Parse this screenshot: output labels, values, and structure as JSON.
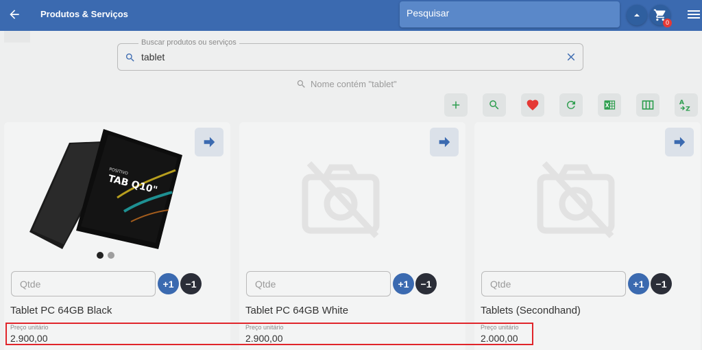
{
  "header": {
    "title": "Produtos & Serviços",
    "search_label": "Pesquisar",
    "cart_count": "0"
  },
  "search": {
    "label": "Buscar produtos ou serviços",
    "value": "tablet"
  },
  "filter": {
    "text": "Nome contém \"tablet\""
  },
  "toolbar": {
    "icons": [
      "add-icon",
      "search-icon",
      "heart-icon",
      "refresh-icon",
      "excel-icon",
      "columns-icon",
      "sort-az-icon"
    ]
  },
  "products": [
    {
      "name": "Tablet PC 64GB Black",
      "price_label": "Preço unitário",
      "price": "2.900,00",
      "qty_placeholder": "Qtde",
      "inc_label": "+1",
      "dec_label": "−1",
      "has_image": true,
      "image_text_brand": "POSITIVO",
      "image_text_model": "TAB Q10\""
    },
    {
      "name": "Tablet PC 64GB White",
      "price_label": "Preço unitário",
      "price": "2.900,00",
      "qty_placeholder": "Qtde",
      "inc_label": "+1",
      "dec_label": "−1",
      "has_image": false
    },
    {
      "name": "Tablets (Secondhand)",
      "price_label": "Preço unitário",
      "price": "2.000,00",
      "qty_placeholder": "Qtde",
      "inc_label": "+1",
      "dec_label": "−1",
      "has_image": false
    }
  ],
  "colors": {
    "appbar": "#3b6ab0",
    "accent_green": "#2e9e4f",
    "heart_red": "#e53935",
    "highlight_red": "#e0242a"
  }
}
